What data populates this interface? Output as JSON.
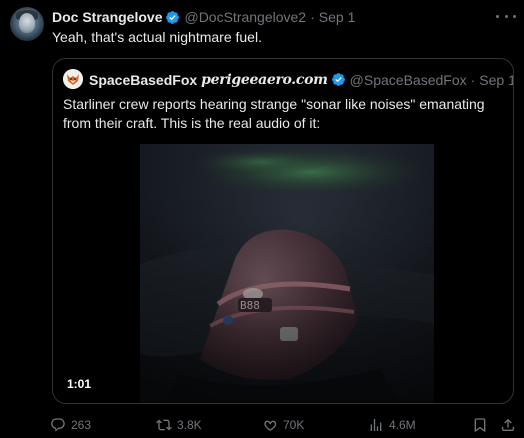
{
  "tweet": {
    "author_name": "Doc Strangelove",
    "author_handle": "@DocStrangelove2",
    "separator": "·",
    "date": "Sep 1",
    "text": "Yeah, that's actual nightmare fuel."
  },
  "quote": {
    "author_name": "SpaceBasedFox",
    "author_site": "perigeeaero.com",
    "author_handle": "@SpaceBasedFox",
    "separator": "·",
    "date": "Sep 1",
    "text": "Starliner crew reports hearing strange \"sonar like noises\" emanating from their craft. This is the real audio of it:",
    "video_duration": "1:01"
  },
  "actions": {
    "replies": "263",
    "reposts": "3.8K",
    "likes": "70K",
    "views": "4.6M"
  },
  "icons": {
    "verified": "verified-badge-icon",
    "more": "more-icon",
    "reply": "reply-icon",
    "repost": "repost-icon",
    "like": "heart-icon",
    "views": "views-icon",
    "bookmark": "bookmark-icon",
    "share": "share-icon"
  },
  "colors": {
    "background": "#000000",
    "text_primary": "#e7e9ea",
    "text_secondary": "#71767b",
    "verified_blue": "#1d9bf0",
    "border": "#2f3336"
  }
}
